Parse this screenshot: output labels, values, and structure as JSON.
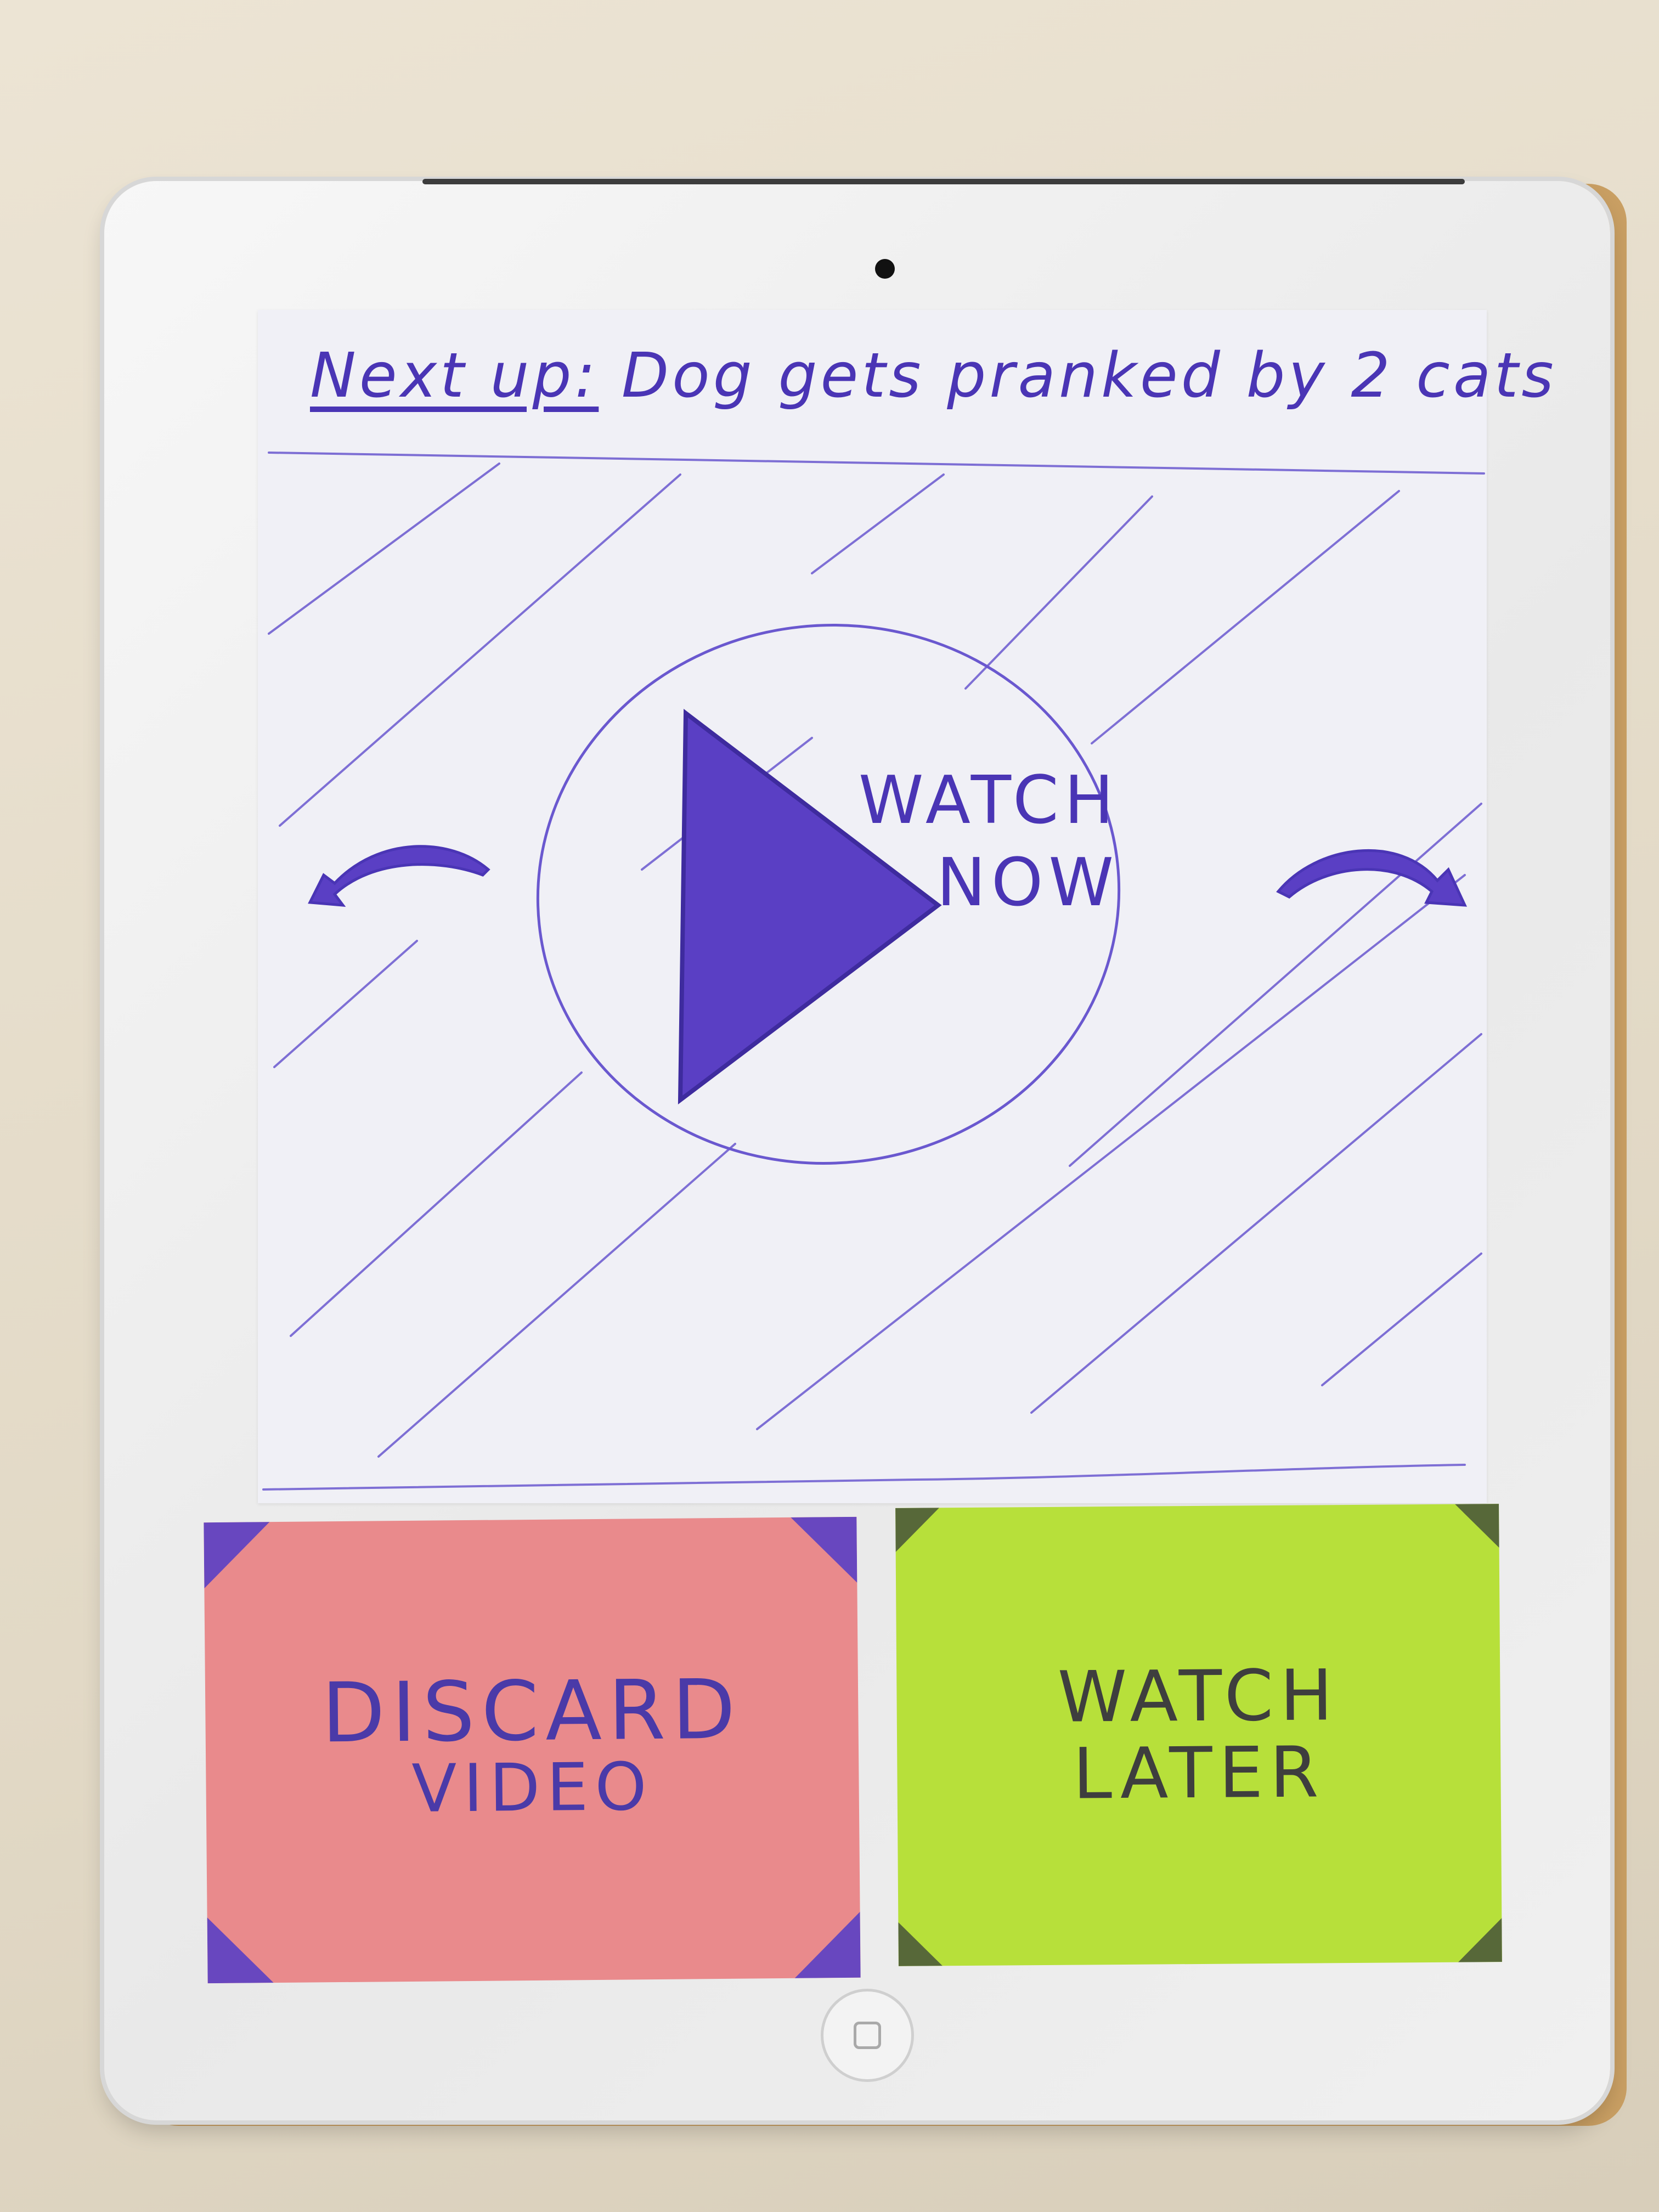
{
  "prototype": {
    "header": {
      "label": "Next up:",
      "video_title": "Dog gets pranked by 2 cats"
    },
    "player": {
      "play_caption_line1": "WATCH",
      "play_caption_line2": "NOW"
    },
    "actions": {
      "discard_line1": "DISCARD",
      "discard_line2": "VIDEO",
      "later_line1": "WATCH",
      "later_line2": "LATER"
    },
    "icons": {
      "play": "play-triangle-icon",
      "swipe_left": "curved-arrow-left-icon",
      "swipe_right": "curved-arrow-right-icon"
    },
    "colors": {
      "ink": "#4a35b5",
      "discard_note": "#e98a8c",
      "later_note": "#b7e03a"
    }
  }
}
